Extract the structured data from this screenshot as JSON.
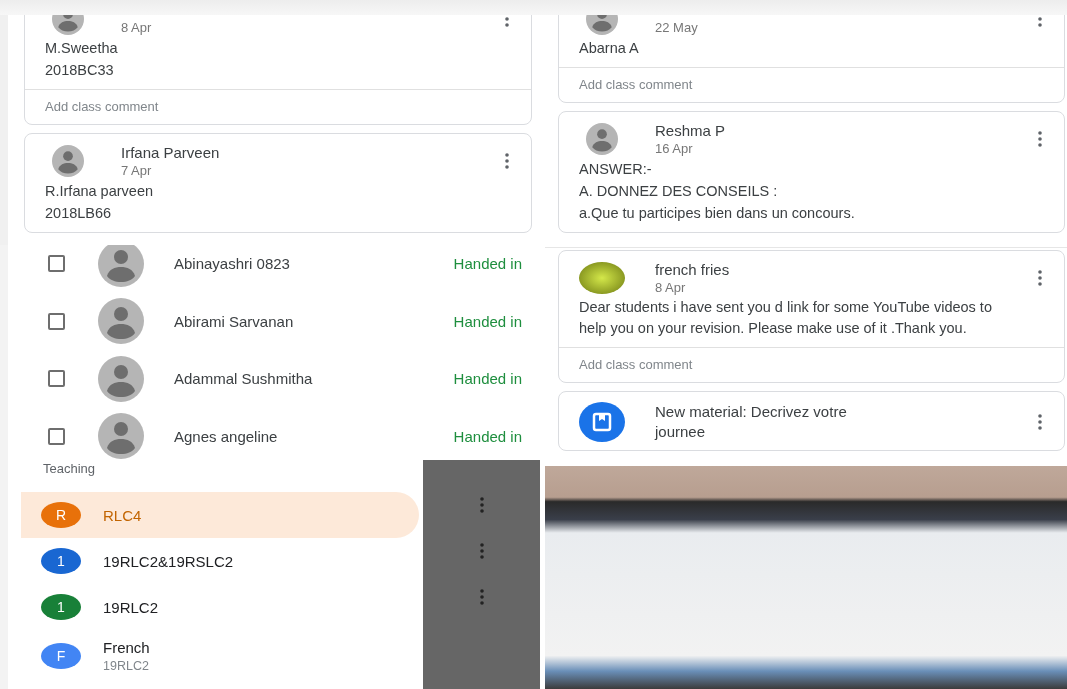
{
  "stream_left": {
    "posts": [
      {
        "kind": "post",
        "date": "8 Apr",
        "lines": [
          "M.Sweetha",
          "2018BC33"
        ],
        "comment_placeholder": "Add class comment"
      },
      {
        "kind": "post",
        "author": "Irfana Parveen",
        "date": "7 Apr",
        "lines": [
          "R.Irfana parveen",
          "2018LB66"
        ]
      }
    ]
  },
  "students": [
    {
      "name": "Abinayashri 0823",
      "status": "Handed in",
      "checked": false
    },
    {
      "name": "Abirami Sarvanan",
      "status": "Handed in",
      "checked": false
    },
    {
      "name": "Adammal Sushmitha",
      "status": "Handed in",
      "checked": false
    },
    {
      "name": "Agnes angeline",
      "status": "Handed in",
      "checked": false
    }
  ],
  "classes": {
    "heading": "Teaching",
    "items": [
      {
        "initial": "R",
        "name": "RLC4",
        "color": "#e8710a",
        "selected": true
      },
      {
        "initial": "1",
        "name": "19RLC2&19RSLC2",
        "color": "#1967d2",
        "selected": false
      },
      {
        "initial": "1",
        "name": "19RLC2",
        "color": "#188038",
        "selected": false
      },
      {
        "initial": "F",
        "name": "French",
        "subtitle": "19RLC2",
        "color": "#4285f4",
        "selected": false
      }
    ]
  },
  "stream_right": {
    "posts": [
      {
        "kind": "post",
        "date": "22 May",
        "lines": [
          "Abarna A"
        ],
        "comment_placeholder": "Add class comment"
      },
      {
        "kind": "post",
        "author": "Reshma P",
        "date": "16 Apr",
        "lines": [
          "ANSWER:-",
          "A. DONNEZ DES CONSEILS :",
          "a.Que tu participes bien dans un concours."
        ]
      }
    ]
  },
  "announcements": {
    "posts": [
      {
        "kind": "photo_post",
        "author": "french fries",
        "date": "8 Apr",
        "lines": [
          "Dear students i have sent you d link for some YouTube videos to help you on your revision. Please make use of it .Thank you."
        ],
        "comment_placeholder": "Add class comment"
      },
      {
        "kind": "material",
        "title": "New material: Decrivez votre journee"
      }
    ]
  }
}
